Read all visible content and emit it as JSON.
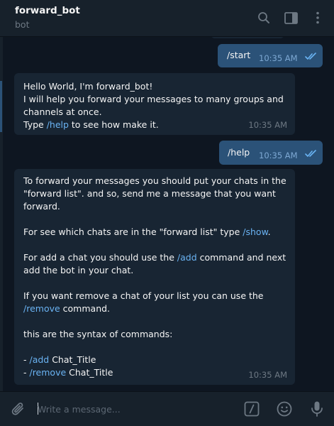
{
  "header": {
    "title": "forward_bot",
    "subtitle": "bot",
    "icons": [
      "search-icon",
      "sidebar-icon",
      "more-icon"
    ]
  },
  "messages": {
    "out_start": {
      "text": "/start",
      "time": "10:35 AM"
    },
    "in_welcome": {
      "greeting": "Hello World, I'm forward_bot!",
      "line2": "I will help you forward your messages to many groups and",
      "line3": "channels at once.",
      "type_prefix": "Type ",
      "help_cmd": "/help",
      "type_suffix": " to see how make it.",
      "time": "10:35 AM"
    },
    "out_help": {
      "text": "/help",
      "time": "10:35 AM"
    },
    "in_help": {
      "p1_l1": "To forward your messages you should put your chats in the",
      "p1_l2": "\"forward list\". and so, send me a message that you want",
      "p1_l3": "forward.",
      "p2_prefix": "For see which chats are in the \"forward list\" type ",
      "p2_cmd": "/show",
      "p2_suffix": ".",
      "p3_prefix": "For add a chat you should use the ",
      "p3_cmd": "/add",
      "p3_suffix": " command and next",
      "p3_l2": "add the bot in your chat.",
      "p4_l1": "If you want remove a chat of your list you can use the",
      "p4_cmd": "/remove",
      "p4_suffix": " command.",
      "p5": "this are the syntax of commands:",
      "syntax_dash": "- ",
      "syntax_add_cmd": "/add",
      "syntax_add_arg": " Chat_Title",
      "syntax_remove_cmd": "/remove",
      "syntax_remove_arg": " Chat_Title",
      "time": "10:35 AM"
    }
  },
  "composer": {
    "placeholder": "Write a message...",
    "icons": [
      "paperclip-icon",
      "commands-icon",
      "emoji-icon",
      "microphone-icon"
    ]
  },
  "colors": {
    "background": "#0e1621",
    "panel": "#17212b",
    "incoming_bubble": "#182533",
    "outgoing_bubble": "#2b5278",
    "link": "#6ab3f3",
    "muted": "#6d7883"
  }
}
